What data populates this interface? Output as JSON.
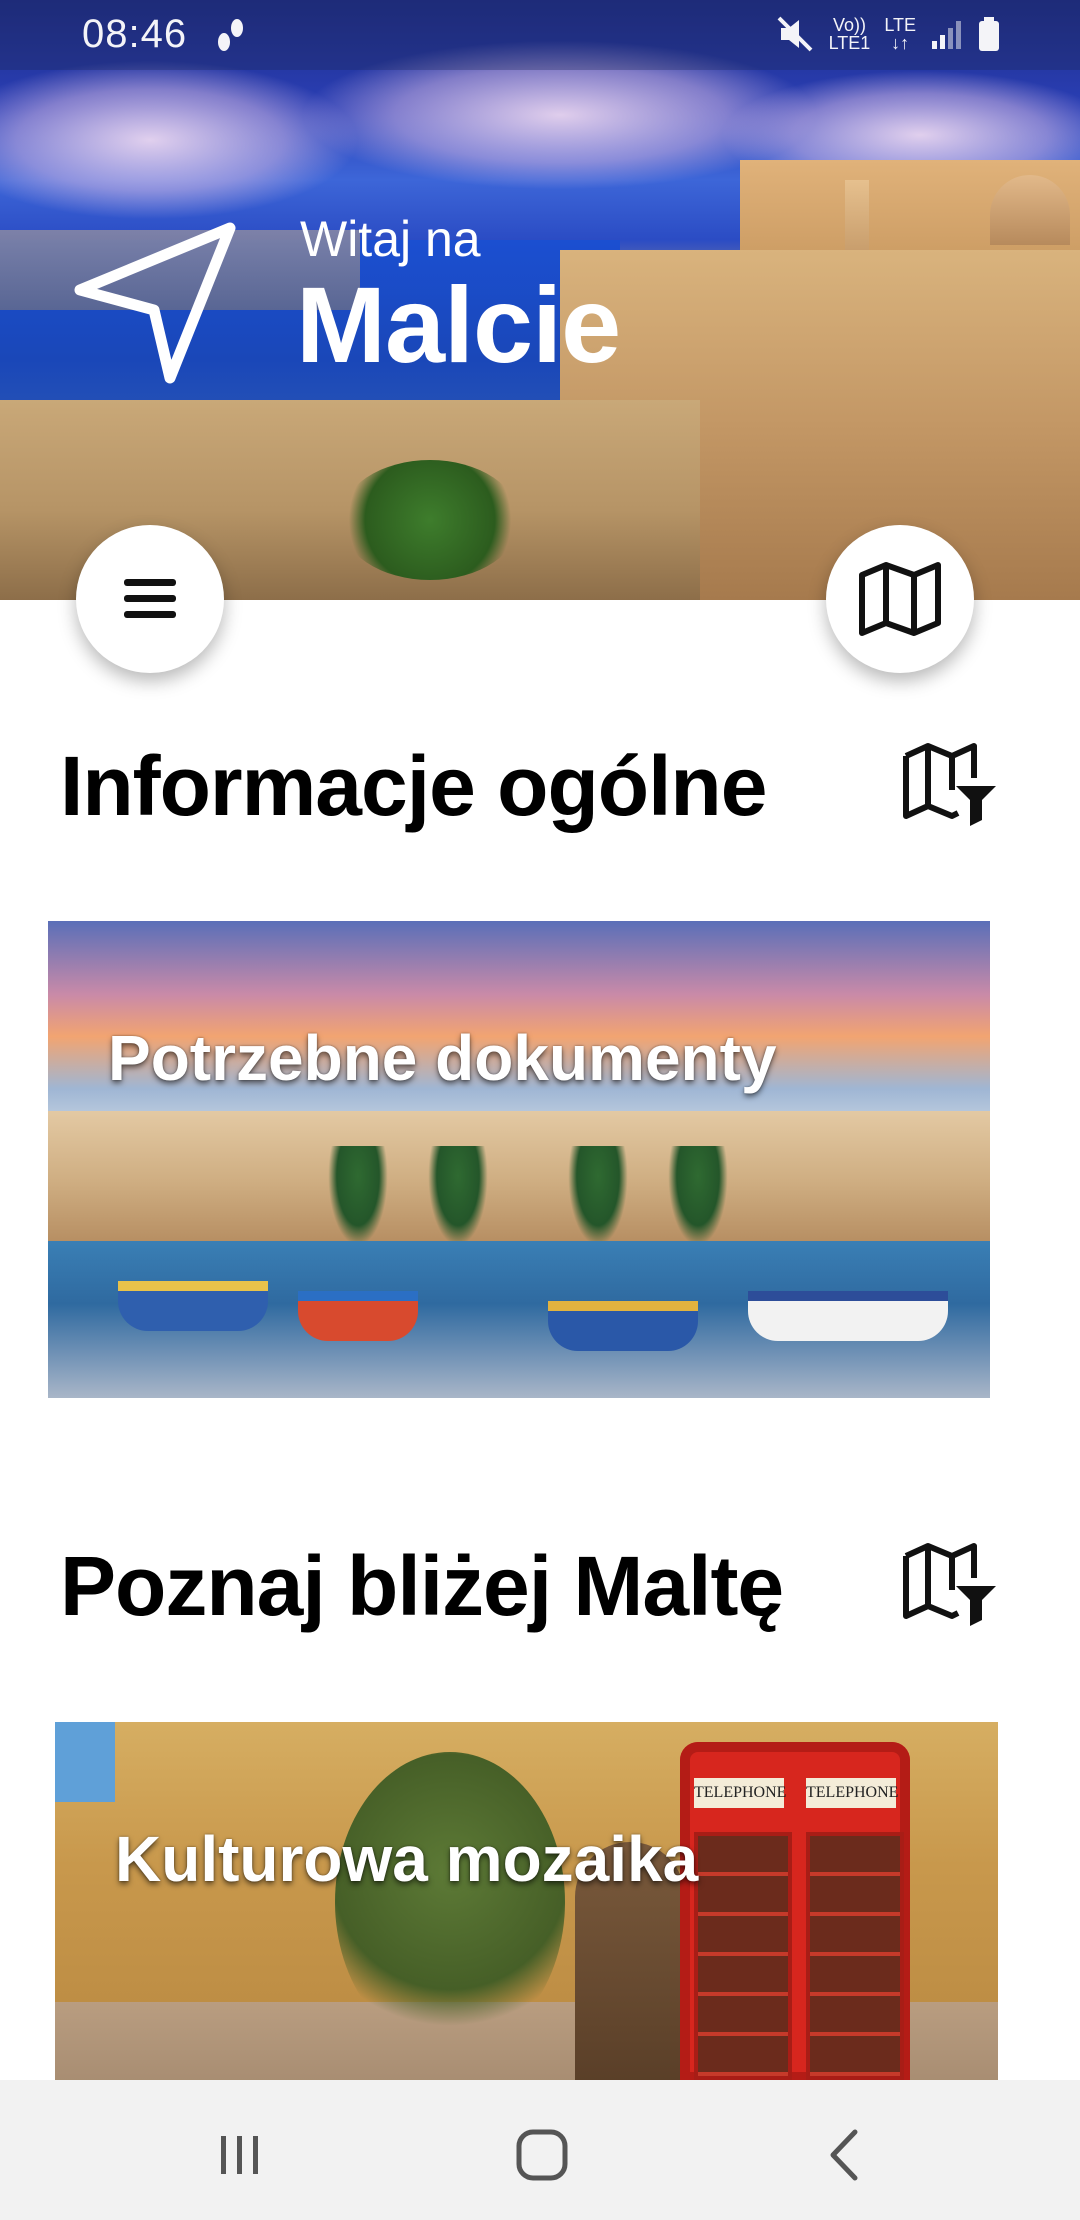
{
  "status_bar": {
    "time": "08:46",
    "volte_label": "Vo))",
    "lte1_label": "LTE1",
    "lte_label": "LTE"
  },
  "hero": {
    "greeting": "Witaj na",
    "place": "Malcie"
  },
  "sections": [
    {
      "title": "Informacje ogólne",
      "card_label": "Potrzebne dokumenty"
    },
    {
      "title": "Poznaj bliżej Maltę",
      "card_label": "Kulturowa mozaika"
    }
  ],
  "card2_scene": {
    "booth_sign": "TELEPHONE"
  },
  "icons": {
    "hero": "navigation-arrow-icon",
    "menu": "hamburger-menu-icon",
    "map": "map-icon",
    "filter": "map-filter-icon",
    "nav_recent": "recent-apps-icon",
    "nav_home": "home-icon",
    "nav_back": "back-icon"
  },
  "colors": {
    "text": "#000000",
    "hero_text": "#ffffff",
    "fab_bg": "#ffffff",
    "navbar_bg": "#f2f2f2"
  }
}
